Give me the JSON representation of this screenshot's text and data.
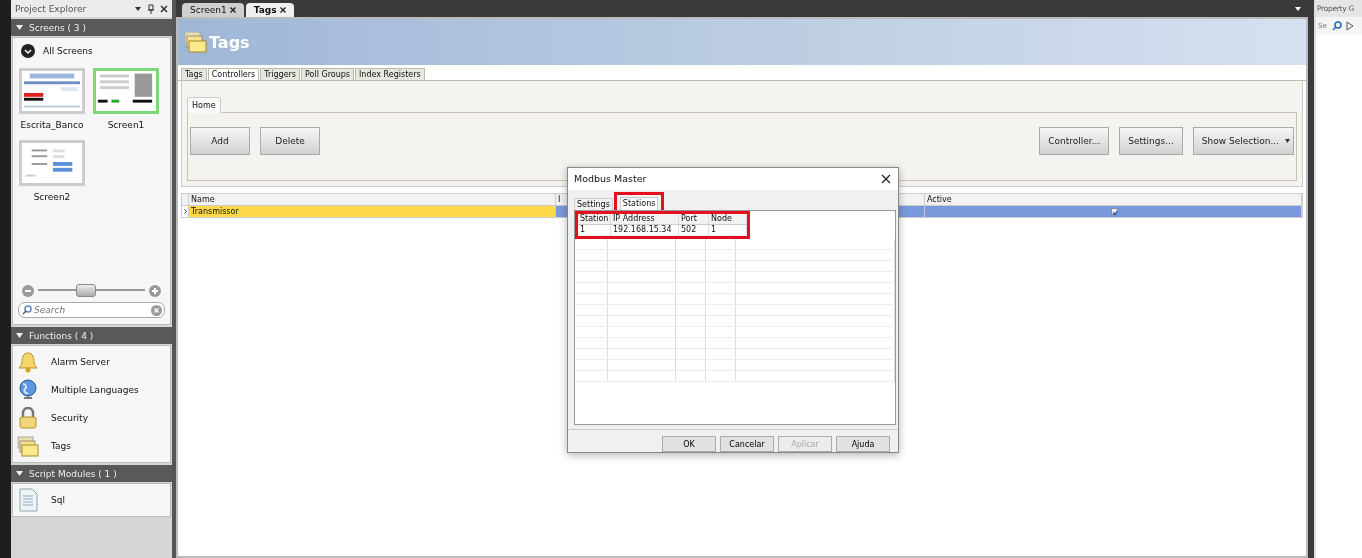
{
  "explorer": {
    "title": "Project Explorer",
    "screens": {
      "title": "Screens ( 3 )",
      "all_label": "All Screens",
      "thumbnails": [
        {
          "label": "Escrita_Banco",
          "selected": false
        },
        {
          "label": "Screen1",
          "selected": true
        },
        {
          "label": "Screen2",
          "selected": false
        }
      ],
      "zoom": {
        "level": 0.45
      },
      "search": {
        "placeholder": "Search"
      }
    },
    "functions": {
      "title": "Functions ( 4 )",
      "items": [
        {
          "label": "Alarm Server",
          "kind": "bell"
        },
        {
          "label": "Multiple Languages",
          "kind": "globe"
        },
        {
          "label": "Security",
          "kind": "lock"
        },
        {
          "label": "Tags",
          "kind": "folders"
        }
      ]
    },
    "scripts": {
      "title": "Script Modules ( 1 )",
      "items": [
        {
          "label": "Sql",
          "kind": "document"
        }
      ]
    }
  },
  "document_tabs": [
    {
      "label": "Screen1",
      "selected": false
    },
    {
      "label": "Tags",
      "selected": true
    }
  ],
  "header": {
    "title": "Tags"
  },
  "tabs": [
    {
      "label": "Tags",
      "selected": false
    },
    {
      "label": "Controllers",
      "selected": true
    },
    {
      "label": "Triggers",
      "selected": false
    },
    {
      "label": "Poll Groups",
      "selected": false
    },
    {
      "label": "Index Registers",
      "selected": false
    }
  ],
  "ribbon": {
    "tab": "Home",
    "left_buttons": [
      "Add",
      "Delete"
    ],
    "right_buttons": [
      {
        "label": "Controller...",
        "dropdown": false
      },
      {
        "label": "Settings...",
        "dropdown": false
      },
      {
        "label": "Show Selection...",
        "dropdown": true
      }
    ]
  },
  "grid": {
    "columns": [
      "Name",
      "I",
      "Active"
    ],
    "rows": [
      {
        "name": "Transmissor",
        "selected": true,
        "active": true
      }
    ]
  },
  "dialog": {
    "title": "Modbus Master",
    "tabs": [
      {
        "label": "Settings",
        "selected": false,
        "highlighted": false
      },
      {
        "label": "Stations",
        "selected": true,
        "highlighted": true
      }
    ],
    "columns": [
      "Station",
      "IP Address",
      "Port",
      "Node"
    ],
    "rows": [
      [
        "1",
        "192.168.15.34",
        "502",
        "1"
      ]
    ],
    "buttons": [
      {
        "label": "OK",
        "disabled": false
      },
      {
        "label": "Cancelar",
        "disabled": false
      },
      {
        "label": "Aplicar",
        "disabled": true
      },
      {
        "label": "Ajuda",
        "disabled": false
      }
    ]
  },
  "property_panel": {
    "title": "Property G",
    "search": {
      "placeholder": "Se"
    }
  }
}
